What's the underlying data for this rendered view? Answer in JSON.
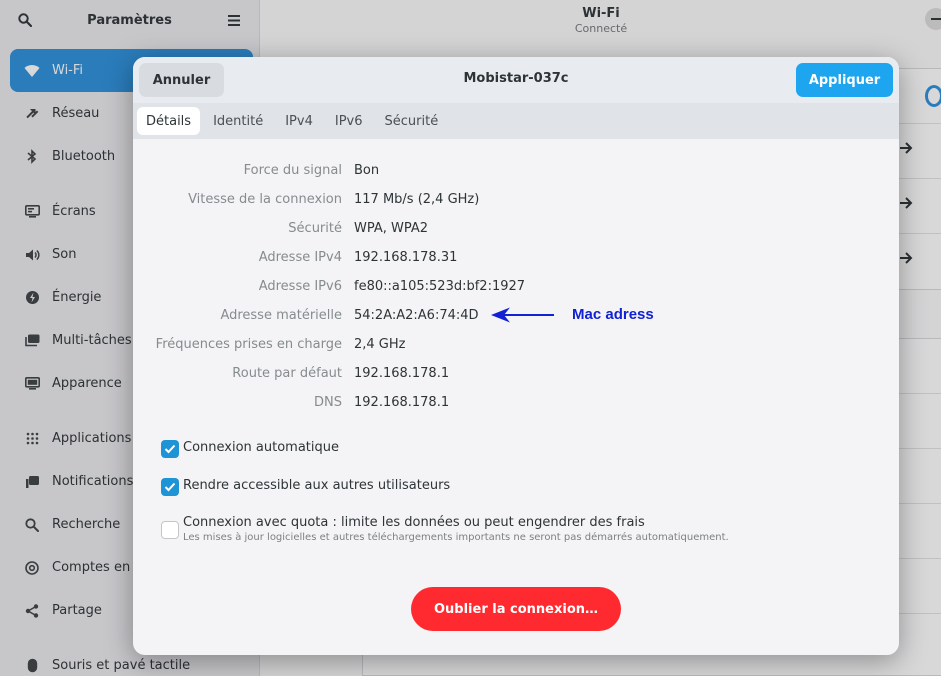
{
  "sidebar": {
    "title": "Paramètres",
    "items": [
      {
        "label": "Wi-Fi",
        "icon": "wifi-icon",
        "active": true
      },
      {
        "label": "Réseau",
        "icon": "network-icon"
      },
      {
        "label": "Bluetooth",
        "icon": "bluetooth-icon"
      },
      {
        "label": "Écrans",
        "icon": "display-icon"
      },
      {
        "label": "Son",
        "icon": "speaker-icon"
      },
      {
        "label": "Énergie",
        "icon": "power-icon"
      },
      {
        "label": "Multi-tâches",
        "icon": "multitask-icon"
      },
      {
        "label": "Apparence",
        "icon": "appearance-icon"
      },
      {
        "label": "Applications",
        "icon": "apps-grid-icon"
      },
      {
        "label": "Notifications",
        "icon": "bell-icon"
      },
      {
        "label": "Recherche",
        "icon": "search-icon"
      },
      {
        "label": "Comptes en",
        "icon": "at-icon"
      },
      {
        "label": "Partage",
        "icon": "share-icon"
      },
      {
        "label": "Souris et pavé tactile",
        "icon": "mouse-icon"
      }
    ]
  },
  "main": {
    "title": "Wi-Fi",
    "subtitle": "Connecté"
  },
  "dialog": {
    "cancel_label": "Annuler",
    "title": "Mobistar-037c",
    "apply_label": "Appliquer",
    "tabs": [
      {
        "label": "Détails",
        "active": true
      },
      {
        "label": "Identité"
      },
      {
        "label": "IPv4"
      },
      {
        "label": "IPv6"
      },
      {
        "label": "Sécurité"
      }
    ],
    "details": [
      {
        "label": "Force du signal",
        "value": "Bon"
      },
      {
        "label": "Vitesse de la connexion",
        "value": "117 Mb/s (2,4 GHz)"
      },
      {
        "label": "Sécurité",
        "value": "WPA, WPA2"
      },
      {
        "label": "Adresse IPv4",
        "value": "192.168.178.31"
      },
      {
        "label": "Adresse IPv6",
        "value": "fe80::a105:523d:bf2:1927"
      },
      {
        "label": "Adresse matérielle",
        "value": "54:2A:A2:A6:74:4D"
      },
      {
        "label": "Fréquences prises en charge",
        "value": "2,4 GHz"
      },
      {
        "label": "Route par défaut",
        "value": "192.168.178.1"
      },
      {
        "label": "DNS",
        "value": "192.168.178.1"
      }
    ],
    "annotation": "Mac adress",
    "checks": {
      "auto_connect": {
        "label": "Connexion automatique",
        "checked": true
      },
      "share_users": {
        "label": "Rendre accessible aux autres utilisateurs",
        "checked": true
      },
      "metered": {
        "label": "Connexion avec quota : limite les données ou peut engendrer des frais",
        "sublabel": "Les mises à jour logicielles et autres téléchargements importants ne seront pas démarrés automatiquement.",
        "checked": false
      }
    },
    "forget_label": "Oublier la connexion…"
  },
  "colors": {
    "accent": "#2b8fdb",
    "apply": "#1da6ef",
    "checkbox": "#1e93d6",
    "danger": "#ff2a2f",
    "annotation": "#1122d4"
  }
}
